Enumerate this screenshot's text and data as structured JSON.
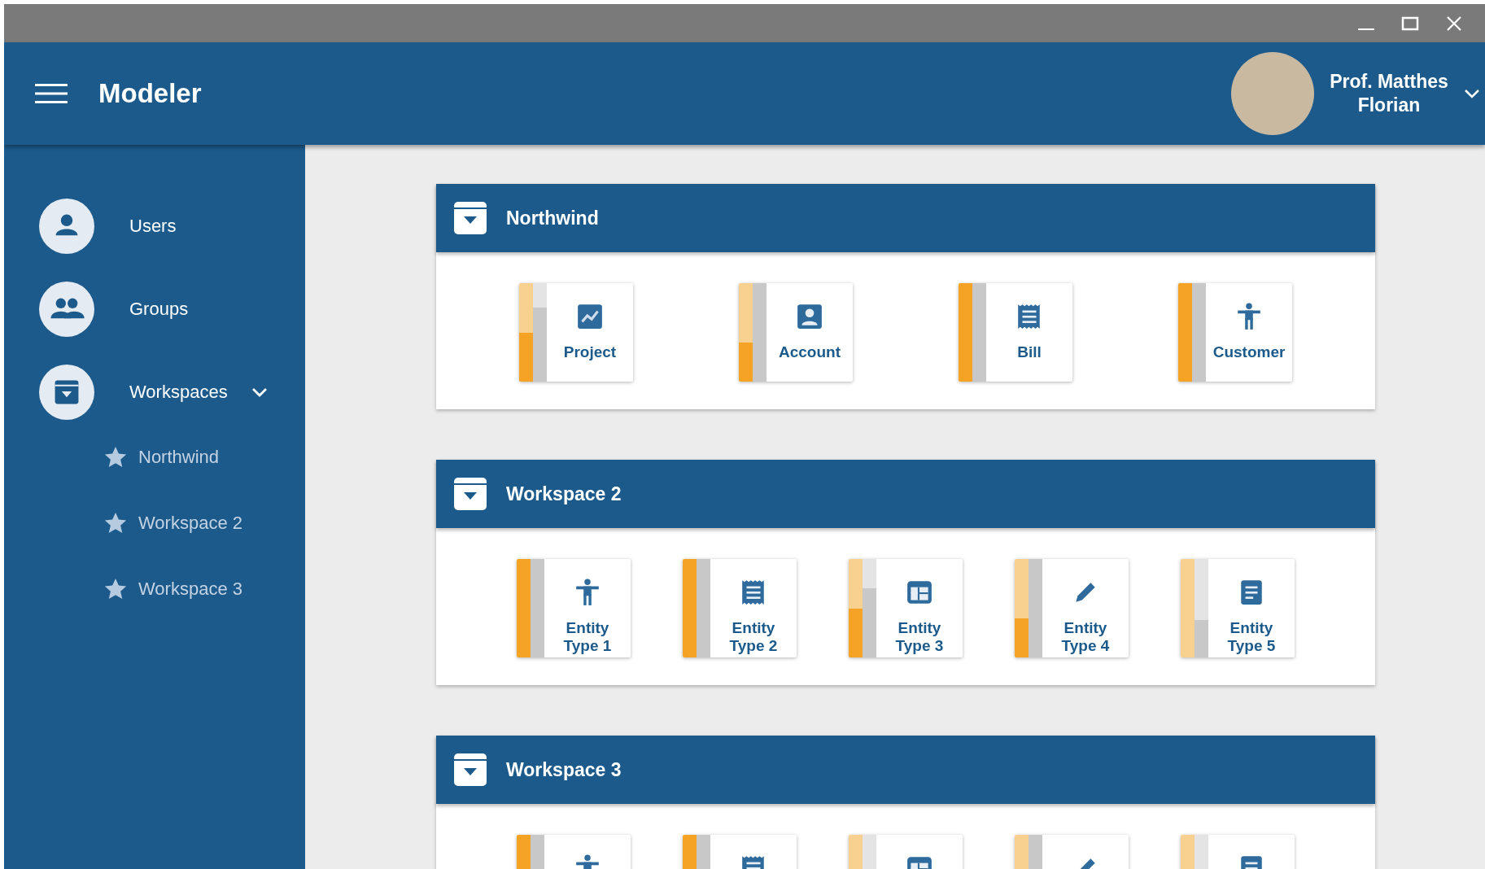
{
  "app_bar": {
    "title": "Modeler",
    "user_name": "Prof. Matthes Florian"
  },
  "sidebar": {
    "items": [
      {
        "label": "Users",
        "kind": "user"
      },
      {
        "label": "Groups",
        "kind": "group"
      },
      {
        "label": "Workspaces",
        "kind": "archive",
        "expanded": true,
        "children": [
          {
            "label": "Northwind"
          },
          {
            "label": "Workspace 2"
          },
          {
            "label": "Workspace 3"
          }
        ]
      }
    ]
  },
  "workspaces": [
    {
      "title": "Northwind",
      "entities": [
        {
          "label": "Project",
          "kind": "chart",
          "primary": {
            "level": 0.5
          },
          "secondary": {
            "level": 0.75
          }
        },
        {
          "label": "Account",
          "kind": "contact",
          "primary": {
            "level": 0.4
          },
          "secondary": {
            "level": 1
          }
        },
        {
          "label": "Bill",
          "kind": "receipt",
          "primary": {
            "level": 1
          },
          "secondary": {
            "level": 1
          }
        },
        {
          "label": "Customer",
          "kind": "figure",
          "primary": {
            "level": 1
          },
          "secondary": {
            "level": 1
          }
        }
      ]
    },
    {
      "title": "Workspace 2",
      "entities": [
        {
          "label": "Entity Type 1",
          "kind": "figure",
          "primary": {
            "level": 1
          },
          "secondary": {
            "level": 1
          }
        },
        {
          "label": "Entity Type 2",
          "kind": "receipt",
          "primary": {
            "level": 1
          },
          "secondary": {
            "level": 1
          }
        },
        {
          "label": "Entity Type 3",
          "kind": "table",
          "primary": {
            "level": 0.5
          },
          "secondary": {
            "level": 0.7
          }
        },
        {
          "label": "Entity Type 4",
          "kind": "pencil",
          "primary": {
            "level": 0.4
          },
          "secondary": {
            "level": 1
          }
        },
        {
          "label": "Entity Type 5",
          "kind": "document",
          "primary": {
            "level": 0
          },
          "secondary": {
            "level": 0.38
          }
        }
      ]
    },
    {
      "title": "Workspace 3",
      "entities": [
        {
          "kind": "figure",
          "primary": {
            "level": 1
          },
          "secondary": {
            "level": 1
          }
        },
        {
          "kind": "receipt",
          "primary": {
            "level": 1
          },
          "secondary": {
            "level": 1
          }
        },
        {
          "kind": "table"
        },
        {
          "kind": "pencil",
          "secondary": {
            "level": 1
          }
        },
        {
          "kind": "document"
        }
      ]
    }
  ]
}
